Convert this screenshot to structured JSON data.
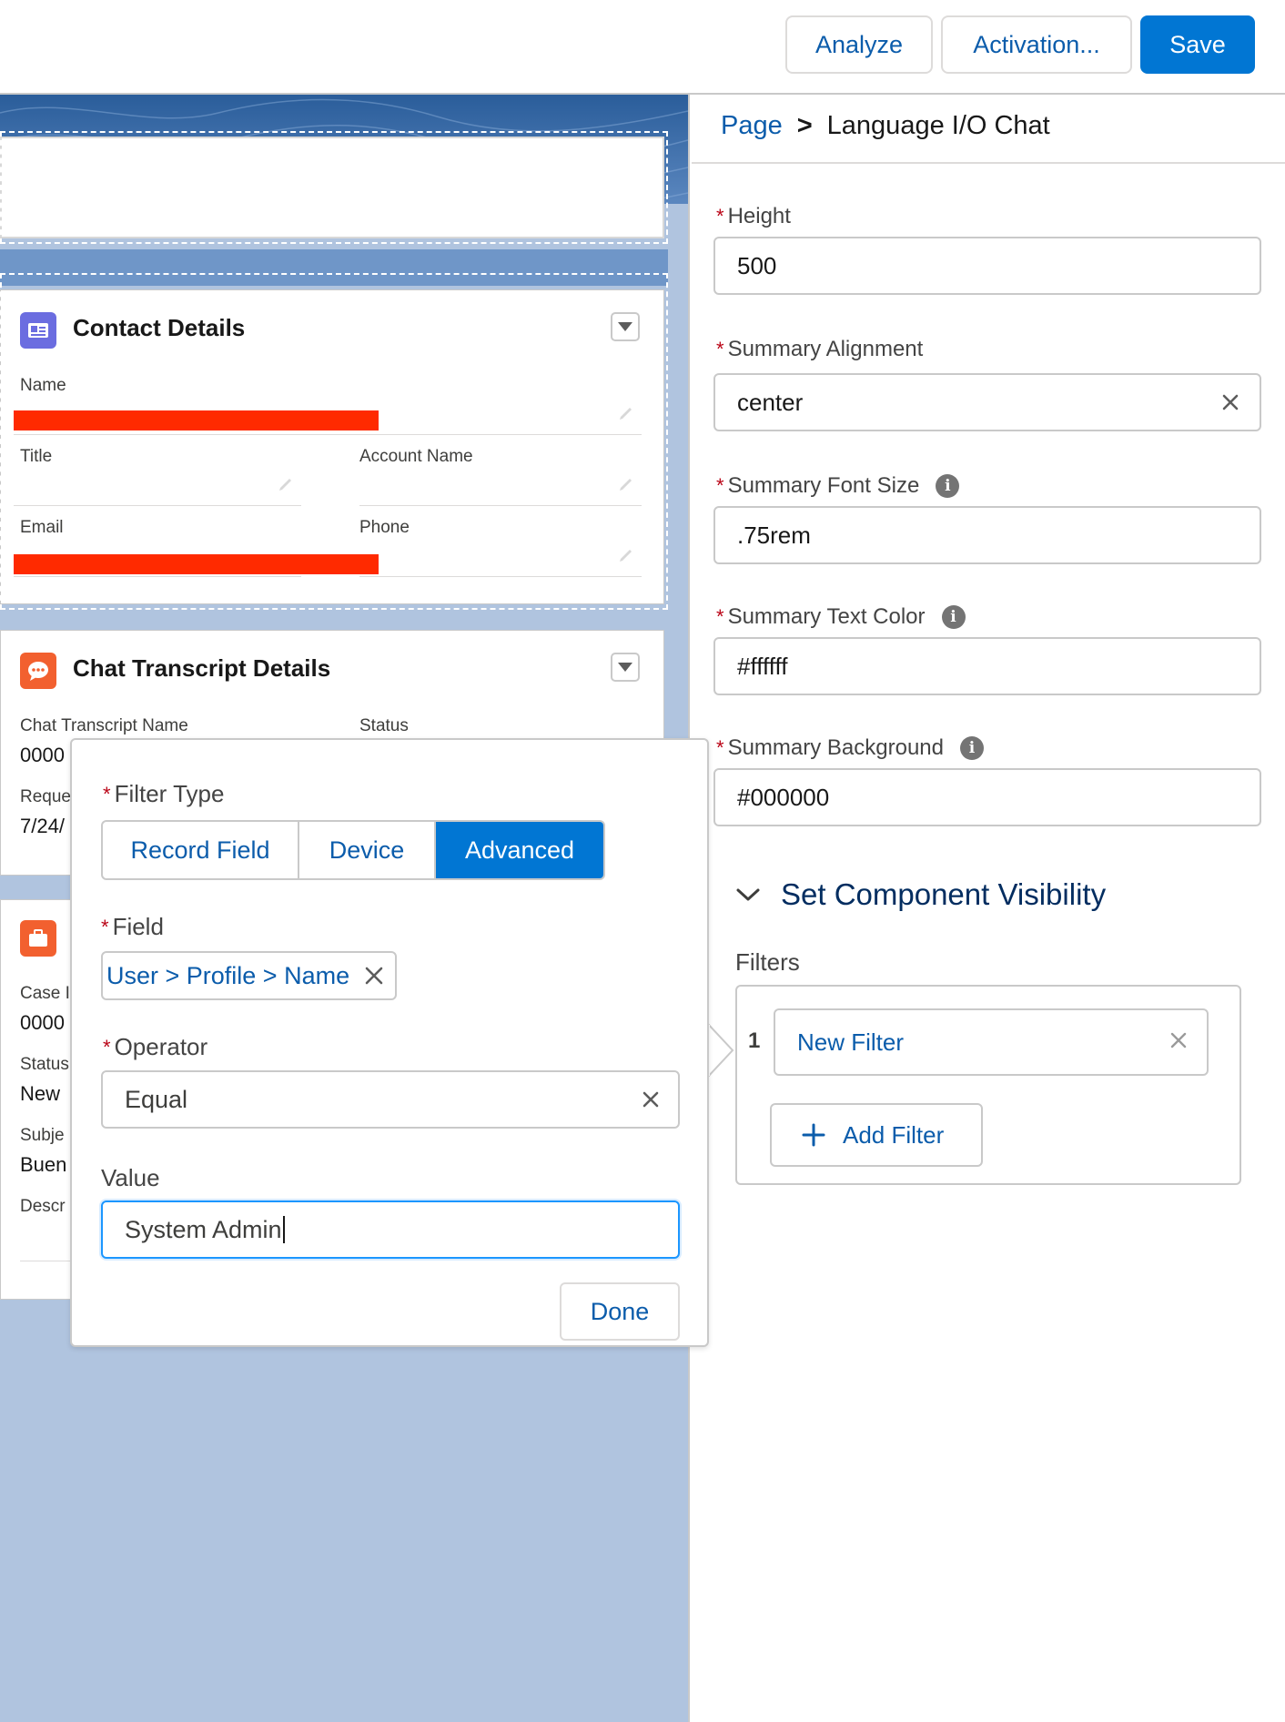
{
  "toolbar": {
    "analyze_label": "Analyze",
    "activation_label": "Activation...",
    "save_label": "Save"
  },
  "canvas": {
    "contact_card": {
      "title": "Contact Details",
      "icon": "contact-card-icon",
      "fields": {
        "name_label": "Name",
        "title_label": "Title",
        "account_label": "Account Name",
        "email_label": "Email",
        "phone_label": "Phone"
      }
    },
    "chat_card": {
      "title": "Chat Transcript Details",
      "icon": "chat-bubble-icon",
      "fields": {
        "name_label": "Chat Transcript Name",
        "name_value": "0000",
        "status_label": "Status",
        "requested_label": "Reque",
        "requested_value": "7/24/"
      }
    },
    "case_card": {
      "icon": "briefcase-icon",
      "fields": {
        "case_label": "Case I",
        "case_value": "0000",
        "status_label": "Status",
        "status_value": "New",
        "subject_label": "Subje",
        "subject_value": "Buen",
        "description_label": "Descr"
      }
    }
  },
  "panel": {
    "breadcrumb": {
      "root": "Page",
      "separator": ">",
      "current": "Language I/O Chat"
    },
    "props": {
      "height": {
        "label": "Height",
        "value": "500"
      },
      "alignment": {
        "label": "Summary Alignment",
        "value": "center"
      },
      "font_size": {
        "label": "Summary Font Size",
        "value": ".75rem"
      },
      "text_color": {
        "label": "Summary Text Color",
        "value": "#ffffff"
      },
      "background": {
        "label": "Summary Background",
        "value": "#000000"
      }
    },
    "visibility": {
      "section_title": "Set Component Visibility",
      "filters_label": "Filters",
      "filter_number": "1",
      "filter_name": "New Filter",
      "add_filter_label": "Add Filter"
    }
  },
  "popover": {
    "filter_type_label": "Filter Type",
    "filter_types": [
      "Record Field",
      "Device",
      "Advanced"
    ],
    "active_filter_type": "Advanced",
    "field_label": "Field",
    "field_value": "User > Profile > Name",
    "operator_label": "Operator",
    "operator_value": "Equal",
    "value_label": "Value",
    "value_input": "System Admin",
    "done_label": "Done"
  },
  "colors": {
    "brand_blue": "#0176d3",
    "link_blue": "#0b5cab",
    "required_red": "#ba0517",
    "canvas_bg": "#b0c4df",
    "redaction": "#ff2a00"
  }
}
